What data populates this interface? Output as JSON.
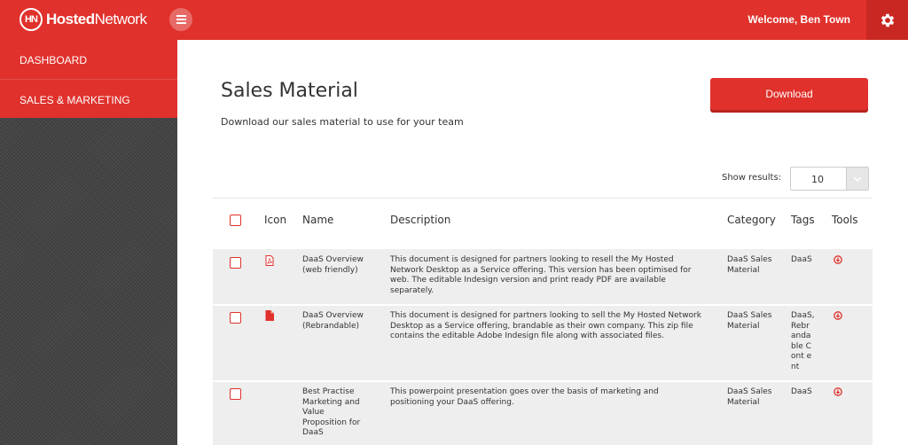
{
  "brand": {
    "logo_mark": "HN",
    "name_part1": "Hosted",
    "name_part2": "Network"
  },
  "header": {
    "welcome": "Welcome, Ben Town",
    "menu_icon": "hamburger-icon",
    "settings_icon": "gear-icon"
  },
  "sidebar": {
    "items": [
      {
        "label": "DASHBOARD"
      },
      {
        "label": "SALES & MARKETING"
      }
    ]
  },
  "page": {
    "title": "Sales Material",
    "subtitle": "Download our sales material to use for your team",
    "download_label": "Download",
    "show_results_label": "Show results:",
    "show_results_value": "10"
  },
  "table": {
    "columns": {
      "icon": "Icon",
      "name": "Name",
      "description": "Description",
      "category": "Category",
      "tags": "Tags",
      "tools": "Tools"
    },
    "rows": [
      {
        "name": "DaaS Overview (web friendly)",
        "description": "This document is designed for partners looking to resell the My Hosted Network Desktop as a Service offering. This version has been optimised for web. The editable Indesign version and print ready PDF are available separately.",
        "category": "DaaS Sales Material",
        "tags": "DaaS",
        "file_icon": "pdf-file-icon"
      },
      {
        "name": "DaaS Overview (Rebrandable)",
        "description": "This document is designed for partners looking to sell the My Hosted Network Desktop as a Service offering, brandable as their own company. This zip file contains the editable Adobe Indesign file along with associated files.",
        "category": "DaaS Sales Material",
        "tags": "DaaS, Rebr anda ble Cont ent",
        "file_icon": "file-icon"
      },
      {
        "name": "Best Practise Marketing and Value Proposition for DaaS",
        "description": "This powerpoint presentation goes over the basis of marketing and positioning your DaaS offering.",
        "category": "DaaS Sales Material",
        "tags": "DaaS",
        "file_icon": ""
      }
    ]
  },
  "colors": {
    "accent": "#e0312c",
    "accent_dark": "#c92822",
    "row_bg": "#eeeeee"
  }
}
